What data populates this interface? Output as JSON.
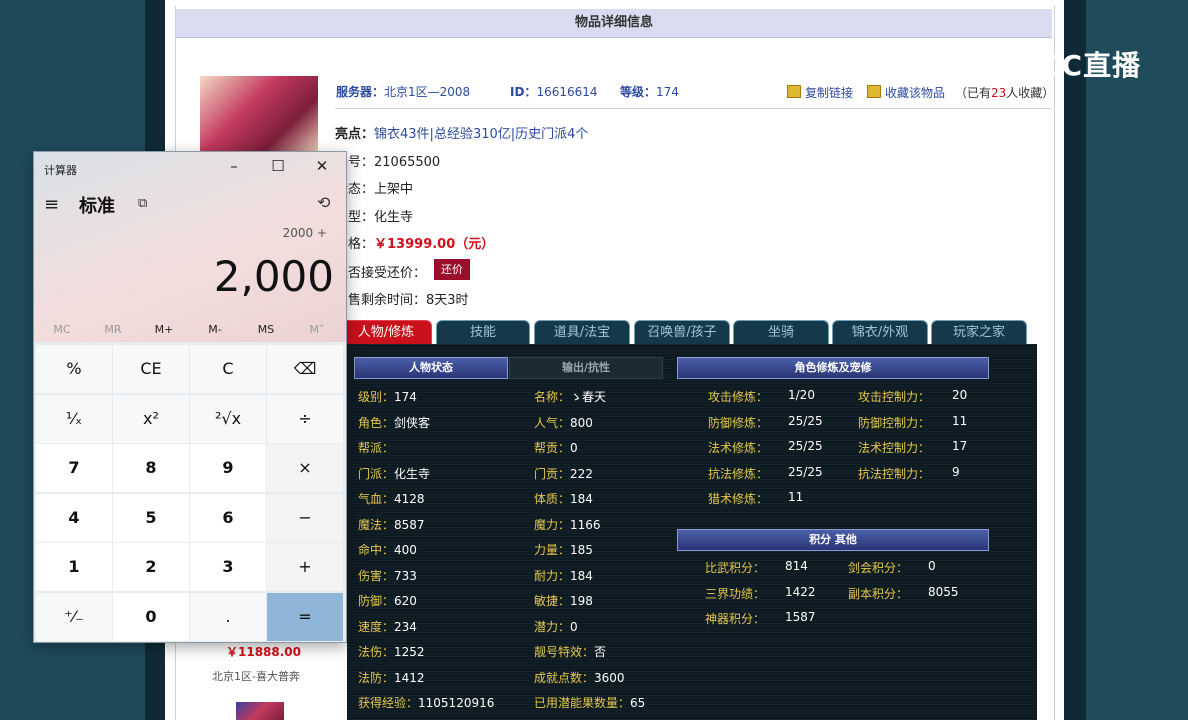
{
  "page": {
    "title": "物品详细信息",
    "server_label": "服务器：",
    "server_value": "北京1区—2008",
    "id_label": "ID：",
    "id_value": "16616614",
    "level_label": "等级：",
    "level_value": "174",
    "copy_link": "复制链接",
    "collect_item": "收藏该物品",
    "collected_prefix": "（已有",
    "collected_count": "23",
    "collected_suffix": "人收藏）",
    "highlight_label": "亮点：",
    "highlight_value": "锦衣43件|总经验310亿|历史门派4个",
    "serial_label": "编号：",
    "serial_value": "21065500",
    "status_label": "状态：",
    "status_value": "上架中",
    "type_label": "类型：",
    "type_value": "化生寺",
    "price_label": "价格：",
    "price_value": "￥13999.00（元）",
    "bargain_label": "是否接受还价：",
    "bargain_button": "还价",
    "remain_label": "出售剩余时间：",
    "remain_value": "8天3时",
    "side_price": "￥11888.00",
    "side_server": "北京1区-喜大普奔"
  },
  "tabs": [
    "人物/修炼",
    "技能",
    "道具/法宝",
    "召唤兽/孩子",
    "坐骑",
    "锦衣/外观",
    "玩家之家"
  ],
  "panel": {
    "head_status": "人物状态",
    "head_resist": "输出/抗性",
    "head_cultivation": "角色修炼及宠修",
    "head_points": "积分 其他",
    "col1": [
      {
        "k": "级别：",
        "v": "174"
      },
      {
        "k": "角色：",
        "v": "剑侠客"
      },
      {
        "k": "帮派：",
        "v": ""
      },
      {
        "k": "门派：",
        "v": "化生寺"
      },
      {
        "k": "气血：",
        "v": "4128"
      },
      {
        "k": "魔法：",
        "v": "8587"
      },
      {
        "k": "命中：",
        "v": "400"
      },
      {
        "k": "伤害：",
        "v": "733"
      },
      {
        "k": "防御：",
        "v": "620"
      },
      {
        "k": "速度：",
        "v": "234"
      },
      {
        "k": "法伤：",
        "v": "1252"
      },
      {
        "k": "法防：",
        "v": "1412"
      },
      {
        "k": "获得经验：",
        "v": "1105120916"
      }
    ],
    "col2": [
      {
        "k": "名称：",
        "v": "ゝ春天"
      },
      {
        "k": "人气：",
        "v": "800"
      },
      {
        "k": "帮贡：",
        "v": "0"
      },
      {
        "k": "门贡：",
        "v": "222"
      },
      {
        "k": "体质：",
        "v": "184"
      },
      {
        "k": "魔力：",
        "v": "1166"
      },
      {
        "k": "力量：",
        "v": "185"
      },
      {
        "k": "耐力：",
        "v": "184"
      },
      {
        "k": "敏捷：",
        "v": "198"
      },
      {
        "k": "潜力：",
        "v": "0"
      },
      {
        "k": "靓号特效：",
        "v": "否"
      },
      {
        "k": "成就点数：",
        "v": "3600"
      },
      {
        "k": "已用潜能果数量：",
        "v": "65"
      }
    ],
    "cult_a": [
      {
        "k": "攻击修炼：",
        "v": "1/20"
      },
      {
        "k": "防御修炼：",
        "v": "25/25"
      },
      {
        "k": "法术修炼：",
        "v": "25/25"
      },
      {
        "k": "抗法修炼：",
        "v": "25/25"
      },
      {
        "k": "猎术修炼：",
        "v": "11"
      }
    ],
    "cult_b": [
      {
        "k": "攻击控制力：",
        "v": "20"
      },
      {
        "k": "防御控制力：",
        "v": "11"
      },
      {
        "k": "法术控制力：",
        "v": "17"
      },
      {
        "k": "抗法控制力：",
        "v": "9"
      }
    ],
    "points_a": [
      {
        "k": "比武积分：",
        "v": "814"
      },
      {
        "k": "三界功绩：",
        "v": "1422"
      },
      {
        "k": "神器积分：",
        "v": "1587"
      }
    ],
    "points_b": [
      {
        "k": "剑会积分：",
        "v": "0"
      },
      {
        "k": "副本积分：",
        "v": "8055"
      }
    ]
  },
  "calculator": {
    "app_title": "计算器",
    "mode": "标准",
    "expression": "2000 +",
    "display": "2,000",
    "memory": [
      "MC",
      "MR",
      "M+",
      "M-",
      "MS",
      "M˅"
    ],
    "keys": [
      "%",
      "CE",
      "C",
      "⌫",
      "¹⁄ₓ",
      "x²",
      "²√x",
      "÷",
      "7",
      "8",
      "9",
      "×",
      "4",
      "5",
      "6",
      "−",
      "1",
      "2",
      "3",
      "+",
      "⁺⁄₋",
      "0",
      ".",
      "="
    ]
  },
  "watermark": "CC直播"
}
